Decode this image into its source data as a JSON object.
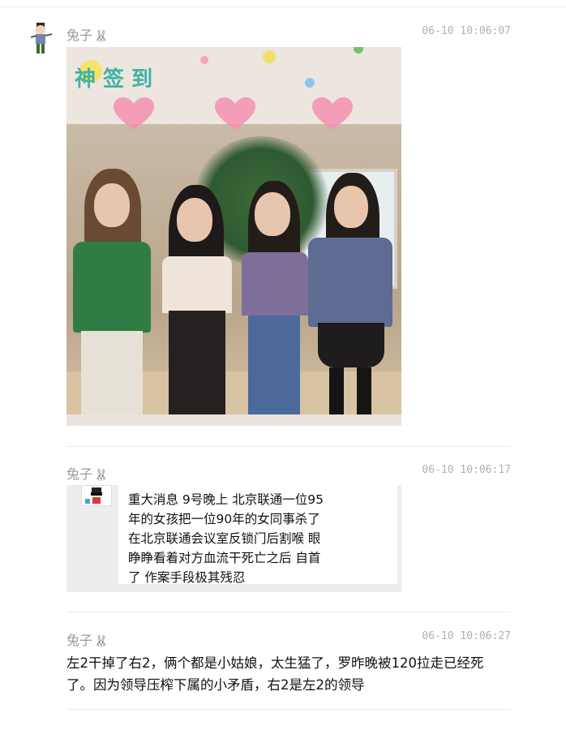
{
  "messages": [
    {
      "author": "兔子",
      "author_badge": "🐰",
      "time": "06-10 10:06:07",
      "photo": {
        "banner_text": "神 签 到"
      }
    },
    {
      "author": "兔子",
      "author_badge": "🐰",
      "time": "06-10 10:06:17",
      "forwarded_text": "重大消息 9号晚上 北京联通一位95年的女孩把一位90年的女同事杀了 在北京联通会议室反锁门后割喉 眼睁睁看着对方血流干死亡之后 自首了 作案手段极其残忍"
    },
    {
      "author": "兔子",
      "author_badge": "🐰",
      "time": "06-10 10:06:27",
      "text": "左2干掉了右2，俩个都是小姑娘，太生猛了，罗昨晚被120拉走已经死了。因为领导压榨下属的小矛盾，右2是左2的领导"
    }
  ],
  "colors": {
    "meta_gray": "#9a9a9a",
    "time_gray": "#b0b0b0",
    "divider": "#eaeaea",
    "heart_pink": "#f48fb1"
  }
}
